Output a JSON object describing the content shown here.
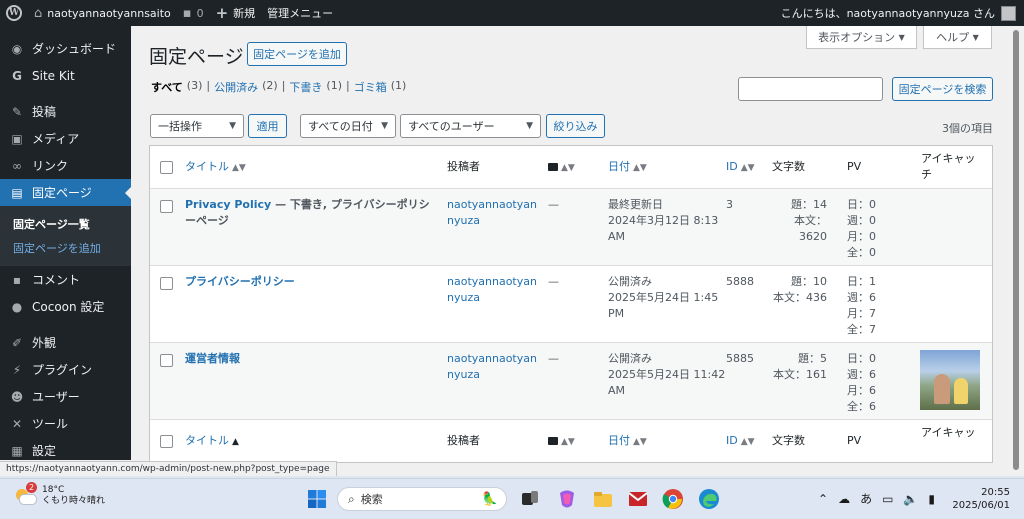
{
  "adminbar": {
    "site_name": "naotyannaotyannsaito",
    "comment_count": "0",
    "new_label": "新規",
    "manage_menu": "管理メニュー",
    "greeting": "こんにちは、naotyannaotyannyuza さん"
  },
  "sidebar": {
    "items": [
      {
        "label": "ダッシュボード",
        "icon": "dashboard-icon"
      },
      {
        "label": "Site Kit",
        "icon": "google-g-icon"
      },
      {
        "label": "投稿",
        "icon": "pin-icon"
      },
      {
        "label": "メディア",
        "icon": "media-icon"
      },
      {
        "label": "リンク",
        "icon": "link-icon"
      },
      {
        "label": "固定ページ",
        "icon": "page-icon"
      },
      {
        "label": "コメント",
        "icon": "comment-icon"
      },
      {
        "label": "Cocoon 設定",
        "icon": "cocoon-icon"
      },
      {
        "label": "外観",
        "icon": "brush-icon"
      },
      {
        "label": "プラグイン",
        "icon": "plugin-icon"
      },
      {
        "label": "ユーザー",
        "icon": "user-icon"
      },
      {
        "label": "ツール",
        "icon": "wrench-icon"
      },
      {
        "label": "設定",
        "icon": "settings-icon"
      }
    ],
    "submenu": {
      "all_pages": "固定ページ一覧",
      "add_page": "固定ページを追加"
    }
  },
  "header": {
    "title": "固定ページ",
    "add_new": "固定ページを追加",
    "screen_options": "表示オプション",
    "help": "ヘルプ"
  },
  "filters": {
    "all_label": "すべて",
    "all_count": "(3)",
    "published_label": "公開済み",
    "published_count": "(2)",
    "draft_label": "下書き",
    "draft_count": "(1)",
    "trash_label": "ゴミ箱",
    "trash_count": "(1)",
    "search_button": "固定ページを検索",
    "search_value": ""
  },
  "tablenav": {
    "bulk_action": "一括操作",
    "apply": "適用",
    "dates": "すべての日付",
    "users": "すべてのユーザー",
    "filter": "絞り込み",
    "items_count": "3個の項目"
  },
  "table": {
    "columns": {
      "title": "タイトル",
      "author": "投稿者",
      "date": "日付",
      "id": "ID",
      "chars": "文字数",
      "pv": "PV",
      "eyecatch_1": "アイキャッ",
      "eyecatch_2": "チ"
    },
    "rows": [
      {
        "title": "Privacy Policy",
        "state": " — 下書き, プライバシーポリシーページ",
        "author_1": "naotyannaotyan",
        "author_2": "nyuza",
        "comments": "—",
        "date_status": "最終更新日",
        "date_1": "2024年3月12日 8:13",
        "date_2": "AM",
        "id": "3",
        "title_chars": "題：14",
        "body_chars": "本文：3620",
        "pv_day": "日：0",
        "pv_week": "週：0",
        "pv_month": "月：0",
        "pv_all": "全：0"
      },
      {
        "title": "プライバシーポリシー",
        "state": "",
        "author_1": "naotyannaotyan",
        "author_2": "nyuza",
        "comments": "—",
        "date_status": "公開済み",
        "date_1": "2025年5月24日 1:45",
        "date_2": "PM",
        "id": "5888",
        "title_chars": "題：10",
        "body_chars": "本文：436",
        "pv_day": "日：1",
        "pv_week": "週：6",
        "pv_month": "月：7",
        "pv_all": "全：7"
      },
      {
        "title": "運営者情報",
        "state": "",
        "author_1": "naotyannaotyan",
        "author_2": "nyuza",
        "comments": "—",
        "date_status": "公開済み",
        "date_1": "2025年5月24日 11:42",
        "date_2": "AM",
        "id": "5885",
        "title_chars": "題：5",
        "body_chars": "本文：161",
        "pv_day": "日：0",
        "pv_week": "週：6",
        "pv_month": "月：6",
        "pv_all": "全：6"
      }
    ]
  },
  "statusbar_url": "https://naotyannaotyann.com/wp-admin/post-new.php?post_type=page",
  "taskbar": {
    "temperature": "18°C",
    "weather": "くもり時々晴れ",
    "weather_badge": "2",
    "search_placeholder": "検索",
    "ime": "あ",
    "time": "20:55",
    "date": "2025/06/01"
  }
}
